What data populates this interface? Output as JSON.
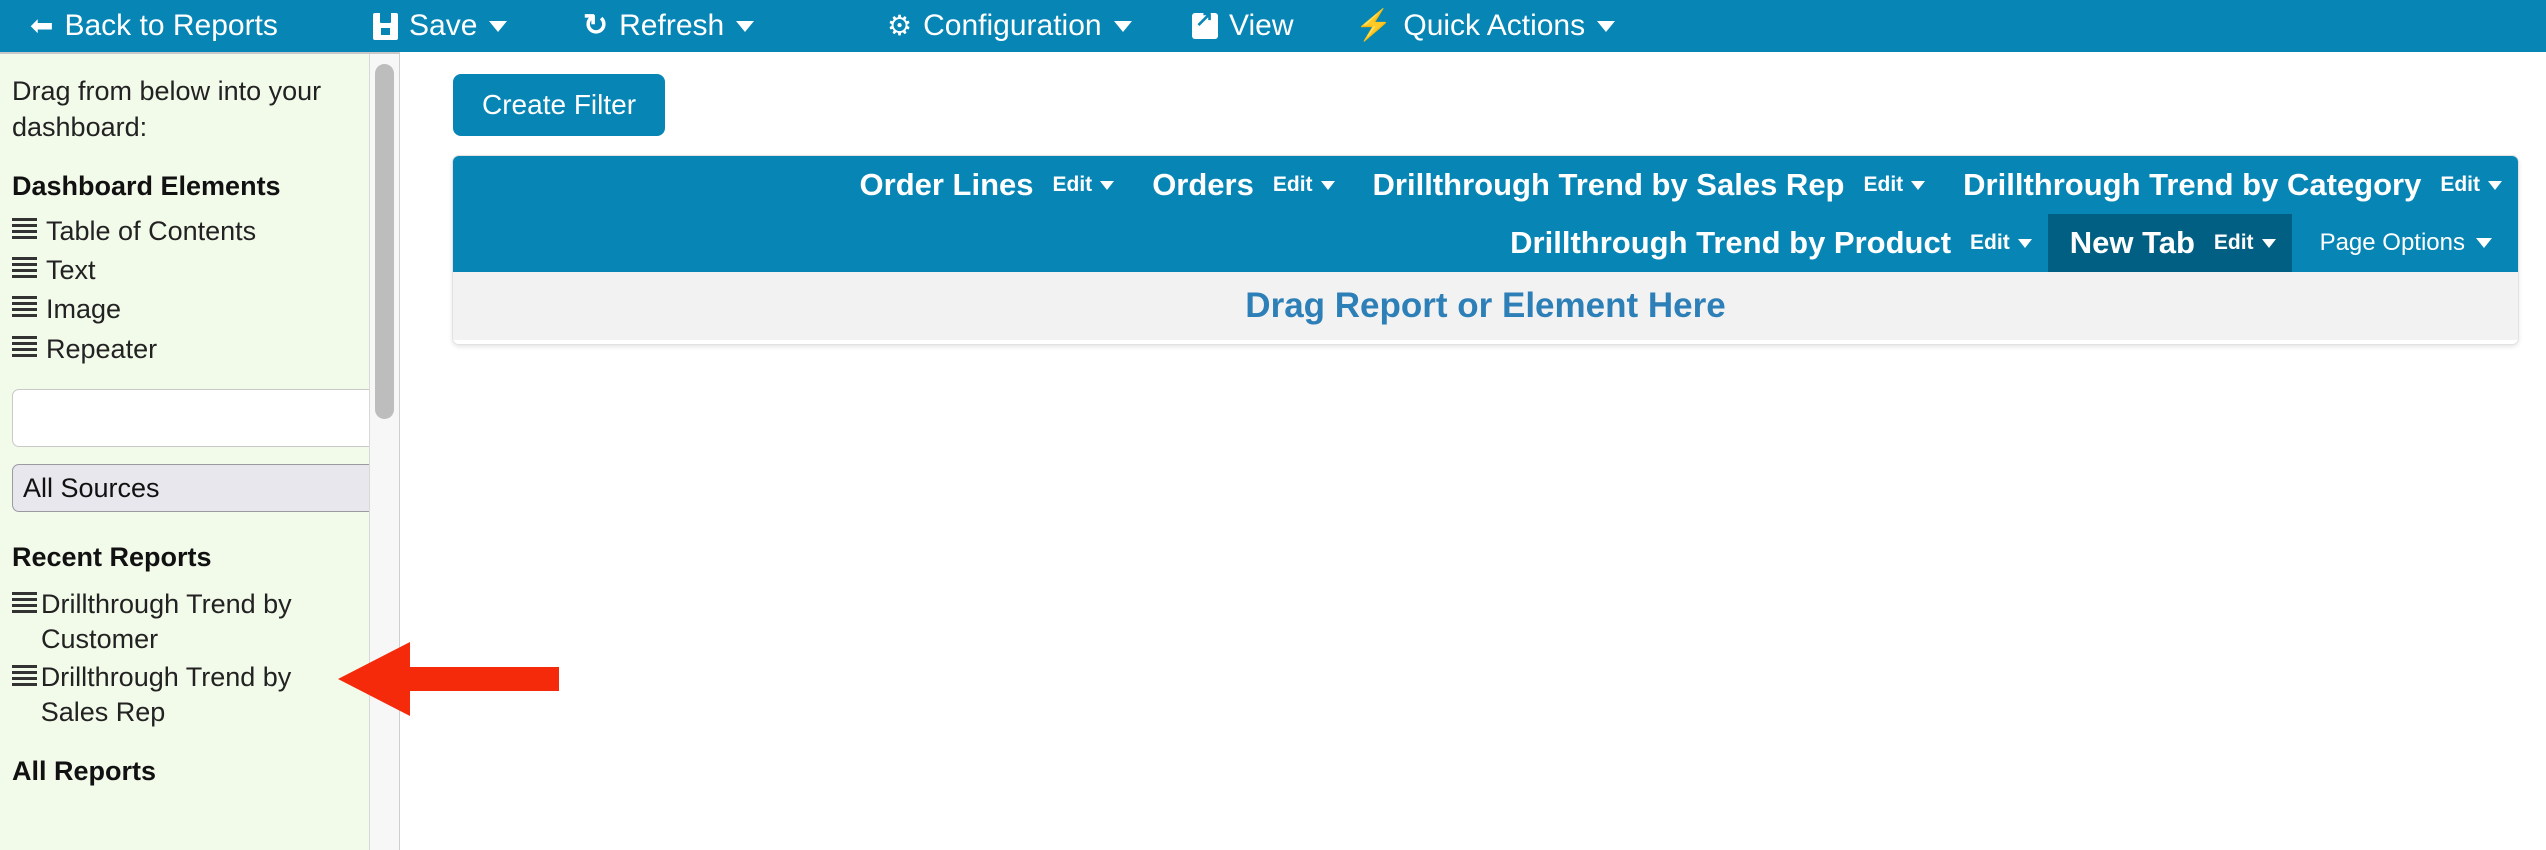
{
  "toolbar": {
    "items": [
      {
        "id": "back",
        "label": "Back to Reports",
        "icon": "arrow-left-icon",
        "caret": false
      },
      {
        "id": "save",
        "label": "Save",
        "icon": "save-icon",
        "caret": true
      },
      {
        "id": "refresh",
        "label": "Refresh",
        "icon": "refresh-icon",
        "caret": true
      },
      {
        "id": "configuration",
        "label": "Configuration",
        "icon": "gear-icon",
        "caret": true
      },
      {
        "id": "view",
        "label": "View",
        "icon": "external-link-icon",
        "caret": false
      },
      {
        "id": "quick_actions",
        "label": "Quick Actions",
        "icon": "bolt-icon",
        "caret": true
      }
    ]
  },
  "sidebar": {
    "intro": "Drag from below into your dashboard:",
    "elements_heading": "Dashboard Elements",
    "elements": [
      {
        "label": "Table of Contents",
        "icon": "drag-handle-icon"
      },
      {
        "label": "Text",
        "icon": "drag-handle-icon"
      },
      {
        "label": "Image",
        "icon": "drag-handle-icon"
      },
      {
        "label": "Repeater",
        "icon": "drag-handle-icon"
      }
    ],
    "search": {
      "value": "",
      "placeholder": ""
    },
    "sources_select": {
      "selected": "All Sources",
      "options": [
        "All Sources"
      ]
    },
    "recent_heading": "Recent Reports",
    "recent_reports": [
      {
        "label": "Drillthrough Trend by Customer",
        "icon": "drag-handle-icon"
      },
      {
        "label": "Drillthrough Trend by Sales Rep",
        "icon": "drag-handle-icon"
      }
    ],
    "all_reports_heading": "All Reports"
  },
  "main": {
    "create_filter_label": "Create Filter",
    "tab_rows": [
      [
        {
          "label": "Order Lines",
          "edit_label": "Edit",
          "active": false
        },
        {
          "label": "Orders",
          "edit_label": "Edit",
          "active": false
        },
        {
          "label": "Drillthrough Trend by Sales Rep",
          "edit_label": "Edit",
          "active": false
        },
        {
          "label": "Drillthrough Trend by Category",
          "edit_label": "Edit",
          "active": false
        }
      ],
      [
        {
          "label": "Drillthrough Trend by Product",
          "edit_label": "Edit",
          "active": false
        },
        {
          "label": "New Tab",
          "edit_label": "Edit",
          "active": true
        }
      ]
    ],
    "page_options_label": "Page Options",
    "dropzone_text": "Drag Report or Element Here"
  },
  "annotation": {
    "arrow": {
      "color": "#f52a0a",
      "direction": "left",
      "points_to": "Drillthrough Trend by Customer"
    }
  },
  "colors": {
    "brand_blue": "#0786b5",
    "active_tab_blue": "#005f82",
    "sidebar_bg": "#f2faea",
    "dropzone_bg": "#f2f2f2",
    "dropzone_text": "#2d7fb8",
    "annotation_red": "#f52a0a"
  }
}
